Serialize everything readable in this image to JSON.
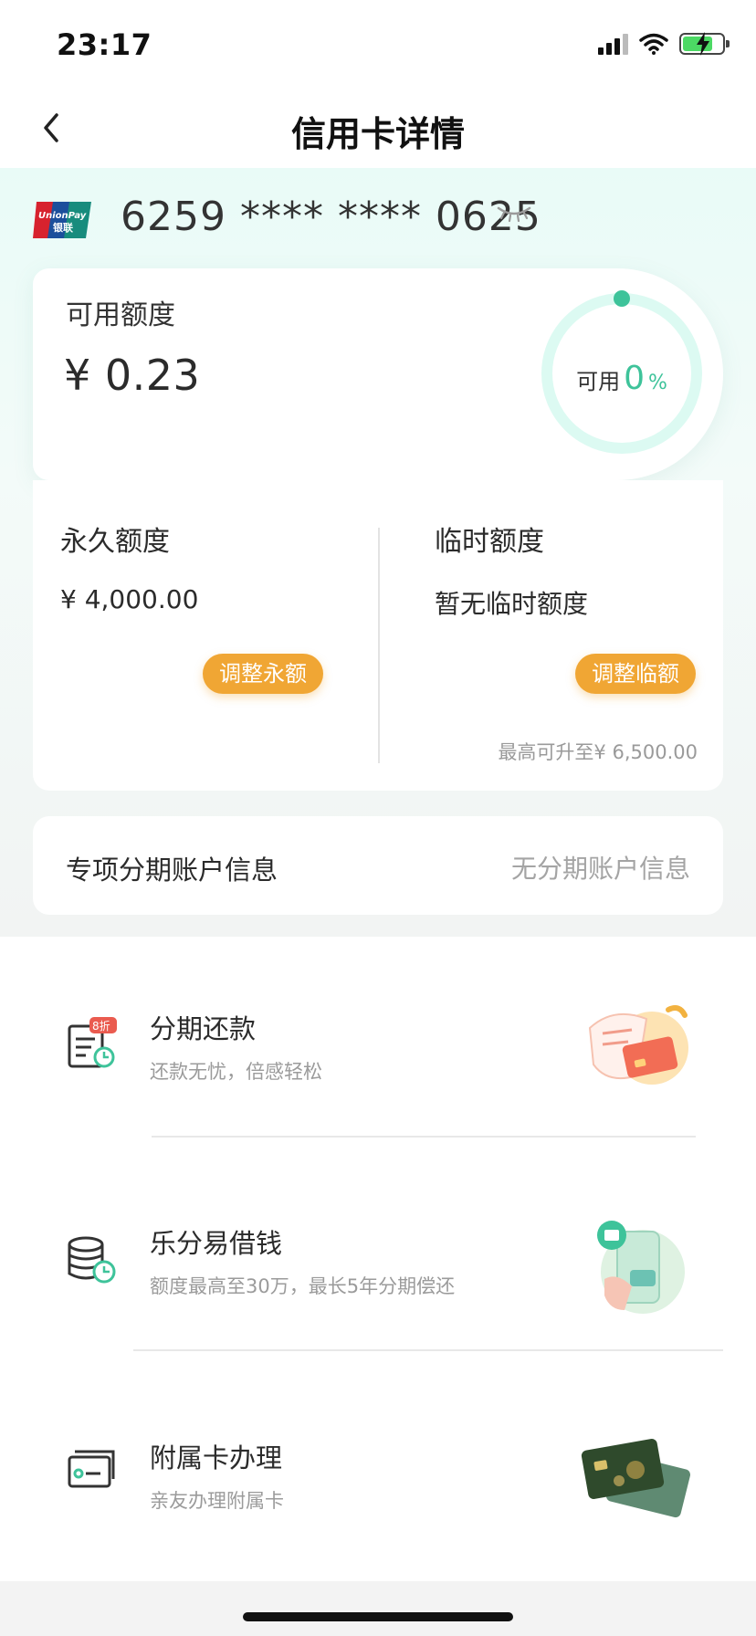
{
  "status": {
    "time": "23:17"
  },
  "nav": {
    "title": "信用卡详情"
  },
  "card": {
    "brand_top": "UnionPay",
    "brand_bottom": "银联",
    "number": "6259 **** **** 0625"
  },
  "available": {
    "label": "可用额度",
    "amount": "¥ 0.23",
    "ring_label": "可用",
    "percent": "0",
    "percent_sign": "%",
    "percent_value": 0
  },
  "permanent": {
    "title": "永久额度",
    "value": "¥ 4,000.00",
    "button": "调整永额"
  },
  "temporary": {
    "title": "临时额度",
    "value": "暂无临时额度",
    "button": "调整临额",
    "note": "最高可升至¥ 6,500.00"
  },
  "installment_account": {
    "label": "专项分期账户信息",
    "value": "无分期账户信息"
  },
  "services": [
    {
      "title": "分期还款",
      "subtitle": "还款无忧，倍感轻松",
      "badge": "8折",
      "icon": "installment-doc-icon"
    },
    {
      "title": "乐分易借钱",
      "subtitle": "额度最高至30万，最长5年分期偿还",
      "icon": "coin-stack-icon"
    },
    {
      "title": "附属卡办理",
      "subtitle": "亲友办理附属卡",
      "icon": "card-icon"
    }
  ],
  "colors": {
    "accent_green": "#3ec39a",
    "accent_orange": "#f0a634",
    "ring_track": "#dcfaf2"
  }
}
